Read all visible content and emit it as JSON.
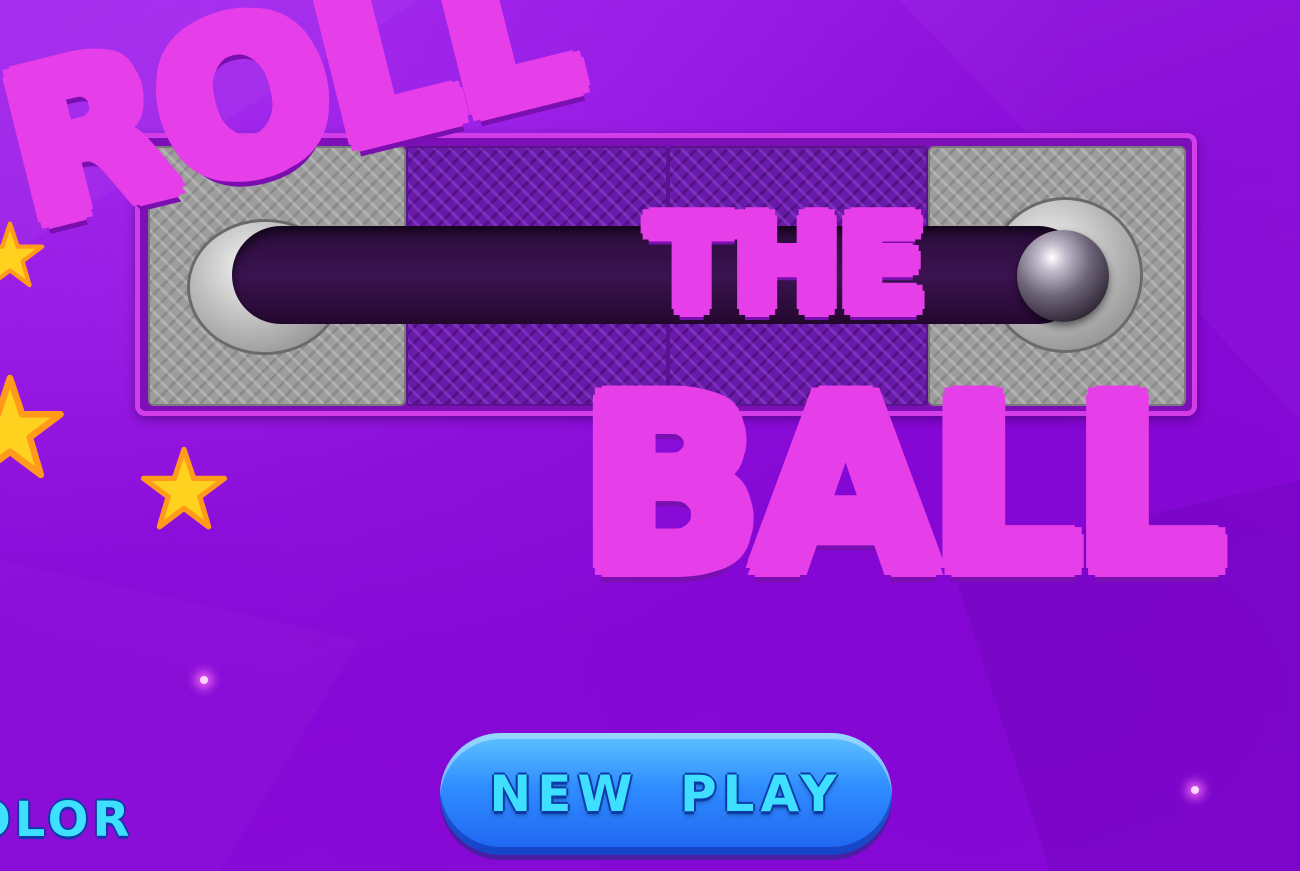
{
  "title": {
    "line1": "ROLL",
    "line2": "THE",
    "line3": "BALL"
  },
  "buttons": {
    "new_play": "NEW PLAY",
    "color": "OLOR"
  },
  "colors": {
    "background": "#8a0fd8",
    "title_gradient_top": "#29d8ff",
    "title_gradient_bottom": "#4f3cf0",
    "title_outline": "#e63ee8",
    "button_blue": "#2f8cff",
    "star_yellow": "#ffd21f"
  },
  "icons": [
    "star-icon",
    "sparkle-icon",
    "steel-ball-icon"
  ]
}
